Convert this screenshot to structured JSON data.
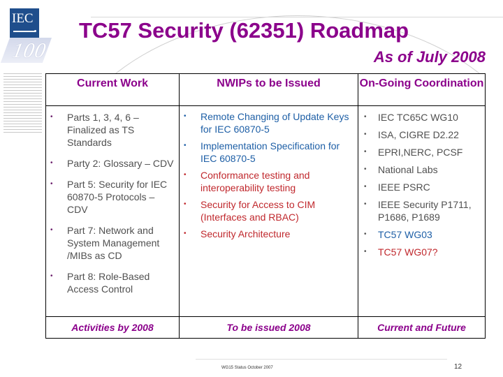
{
  "slide": {
    "title": "TC57 Security (62351) Roadmap",
    "subtitle": "As of July 2008",
    "logo": {
      "text": "IEC",
      "shadow_text": "100"
    },
    "footer": {
      "text": "WG15 Status October 2007",
      "page_number": "12"
    }
  },
  "colors": {
    "title": "#8b008b",
    "blue_item": "#1e5fa6",
    "red_item": "#c0282d",
    "gray_item": "#505050"
  },
  "table": {
    "headers": [
      "Current Work",
      "NWIPs to be Issued",
      "On-Going Coordination"
    ],
    "footers": [
      "Activities by 2008",
      "To be issued 2008",
      "Current and Future"
    ],
    "current_work": [
      {
        "text": "Parts 1, 3, 4, 6 – Finalized as TS Standards"
      },
      {
        "text": "Party 2: Glossary – CDV"
      },
      {
        "text": "Part 5: Security for IEC 60870-5 Protocols – CDV"
      },
      {
        "text": "Part 7: Network and System Management /MIBs as CD"
      },
      {
        "text": "Part 8: Role-Based Access Control"
      }
    ],
    "nwips": [
      {
        "text": "Remote Changing of Update Keys for IEC 60870-5",
        "color": "blue"
      },
      {
        "text": "Implementation Specification for IEC 60870-5",
        "color": "blue"
      },
      {
        "text": "Conformance testing and interoperability testing",
        "color": "red"
      },
      {
        "text": "Security for Access to CIM (Interfaces and RBAC)",
        "color": "red"
      },
      {
        "text": "Security Architecture",
        "color": "red"
      }
    ],
    "coordination": [
      {
        "text": "IEC TC65C WG10",
        "color": "gray"
      },
      {
        "text": "ISA, CIGRE D2.22",
        "color": "gray"
      },
      {
        "text": "EPRI,NERC, PCSF",
        "color": "gray"
      },
      {
        "text": "National Labs",
        "color": "gray"
      },
      {
        "text": "IEEE PSRC",
        "color": "gray"
      },
      {
        "text": "IEEE Security P1711, P1686, P1689",
        "color": "gray"
      },
      {
        "text": "TC57 WG03",
        "color": "blue"
      },
      {
        "text": "TC57 WG07?",
        "color": "red"
      }
    ]
  }
}
